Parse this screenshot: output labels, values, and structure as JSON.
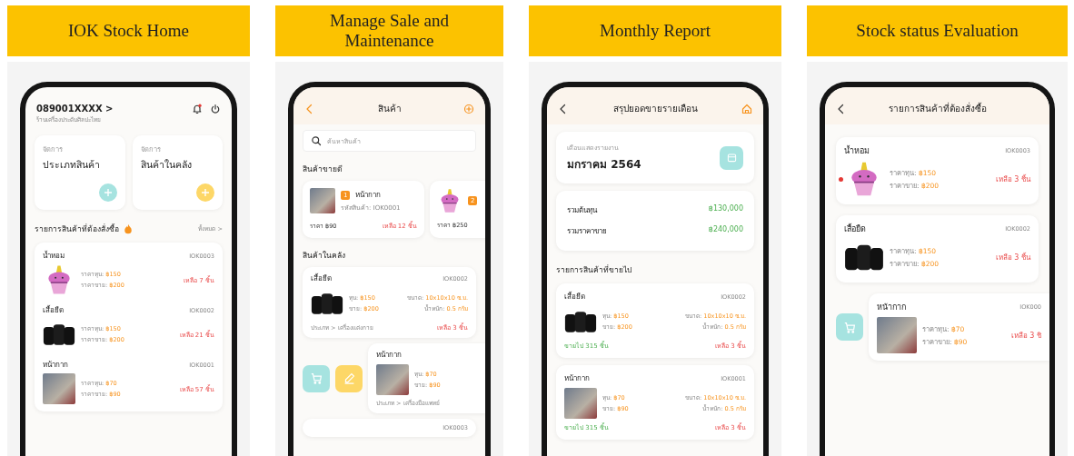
{
  "panels": [
    {
      "kind": "home",
      "title": "IOK Stock Home",
      "phone": "089001XXXX >",
      "shop": "ร้านเครื่องประดับศิลปะไทย",
      "tiles": [
        {
          "caption": "จัดการ",
          "label": "ประเภทสินค้า",
          "color": "#a6e3e0"
        },
        {
          "caption": "จัดการ",
          "label": "สินค้าในคลัง",
          "color": "#fdd767"
        }
      ],
      "section": "รายการสินค้าที่ต้องสั่งซื้อ",
      "see_all": "ทั้งหมด >",
      "items": [
        {
          "name": "น้ำหอม",
          "code": "IOK0003",
          "kind": "doll",
          "cost_label": "ราคาทุน:",
          "cost": "฿150",
          "price_label": "ราคาขาย:",
          "price": "฿200",
          "remaining": "เหลือ 7 ชิ้น"
        },
        {
          "name": "เสื้อยืด",
          "code": "IOK0002",
          "kind": "shirts",
          "cost_label": "ราคาทุน:",
          "cost": "฿150",
          "price_label": "ราคาขาย:",
          "price": "฿200",
          "remaining": "เหลือ 21 ชิ้น"
        },
        {
          "name": "หน้ากาก",
          "code": "IOK0001",
          "kind": "photo",
          "cost_label": "ราคาทุน:",
          "cost": "฿70",
          "price_label": "ราคาขาย:",
          "price": "฿90",
          "remaining": "เหลือ 57 ชิ้น"
        }
      ]
    },
    {
      "kind": "products",
      "title": "Manage Sale and Maintenance",
      "header": "สินค้า",
      "search": {
        "placeholder": "ค้นหาสินค้า"
      },
      "best_title": "สินค้าขายดี",
      "best": [
        {
          "rank": "1",
          "name": "หน้ากาก",
          "code_label": "รหัสสินค้า:",
          "code": "IOK0001",
          "kind": "photo",
          "price": "ราคา ฿90",
          "remaining": "เหลือ 12 ชิ้น"
        },
        {
          "rank": "2",
          "kind": "doll",
          "price": "ราคา ฿250"
        }
      ],
      "stock_title": "สินค้าในคลัง",
      "items": [
        {
          "name": "เสื้อยืด",
          "code": "IOK0002",
          "kind": "shirts",
          "cost_label": "ทุน:",
          "cost": "฿150",
          "price_label": "ขาย:",
          "price": "฿200",
          "size_label": "ขนาด:",
          "size": "10x10x10 ซ.ม.",
          "weight_label": "น้ำหนัก:",
          "weight": "0.5 กรัม",
          "category": "ประเภท > เครื่องแต่งกาย",
          "remaining": "เหลือ 3 ชิ้น"
        },
        {
          "name": "หน้ากาก",
          "kind": "photo",
          "cost_label": "ทุน:",
          "cost": "฿70",
          "price_label": "ขาย:",
          "price": "฿90",
          "category": "ประเภท > เครื่องมือแพทย์",
          "actions": [
            {
              "kind": "cart"
            },
            {
              "kind": "edit"
            }
          ]
        },
        {
          "code": "IOK0003"
        }
      ]
    },
    {
      "kind": "report",
      "title": "Monthly Report",
      "header": "สรุปยอดขายรายเดือน",
      "month_label": "เดือนแสดงรายงาน",
      "month": "มกราคม 2564",
      "totals": [
        {
          "label": "รวมต้นทุน",
          "value": "฿130,000"
        },
        {
          "label": "รวมราคาขาย",
          "value": "฿240,000"
        }
      ],
      "section": "รายการสินค้าที่ขายไป",
      "items": [
        {
          "name": "เสื้อยืด",
          "code": "IOK0002",
          "kind": "shirts",
          "cost_label": "ทุน:",
          "cost": "฿150",
          "price_label": "ขาย:",
          "price": "฿200",
          "size_label": "ขนาด:",
          "size": "10x10x10 ซ.ม.",
          "weight_label": "น้ำหนัก:",
          "weight": "0.5 กรัม",
          "sold": "ขายไป 315 ชิ้น",
          "remaining": "เหลือ 3 ชิ้น"
        },
        {
          "name": "หน้ากาก",
          "code": "IOK0001",
          "kind": "photo",
          "cost_label": "ทุน:",
          "cost": "฿70",
          "price_label": "ขาย:",
          "price": "฿90",
          "size_label": "ขนาด:",
          "size": "10x10x10 ซ.ม.",
          "weight_label": "น้ำหนัก:",
          "weight": "0.5 กรัม",
          "sold": "ขายไป 315 ชิ้น",
          "remaining": "เหลือ 3 ชิ้น"
        }
      ]
    },
    {
      "kind": "reorder",
      "title": "Stock status Evaluation",
      "header": "รายการสินค้าที่ต้องสั่งซื้อ",
      "items": [
        {
          "name": "น้ำหอม",
          "code": "IOK0003",
          "kind": "doll",
          "alert": true,
          "cost_label": "ราคาทุน:",
          "cost": "฿150",
          "price_label": "ราคาขาย:",
          "price": "฿200",
          "remaining": "เหลือ 3 ชิ้น"
        },
        {
          "name": "เสื้อยืด",
          "code": "IOK0002",
          "kind": "shirts",
          "alert": false,
          "cost_label": "ราคาทุน:",
          "cost": "฿150",
          "price_label": "ราคาขาย:",
          "price": "฿200",
          "remaining": "เหลือ 3 ชิ้น"
        },
        {
          "name": "หน้ากาก",
          "code": "IOK000",
          "kind": "photo",
          "alert": false,
          "cost_label": "ราคาทุน:",
          "cost": "฿70",
          "price_label": "ราคาขาย:",
          "price": "฿90",
          "remaining": "เหลือ 3 ชิ",
          "actions": [
            {
              "kind": "cart"
            }
          ]
        }
      ]
    }
  ]
}
